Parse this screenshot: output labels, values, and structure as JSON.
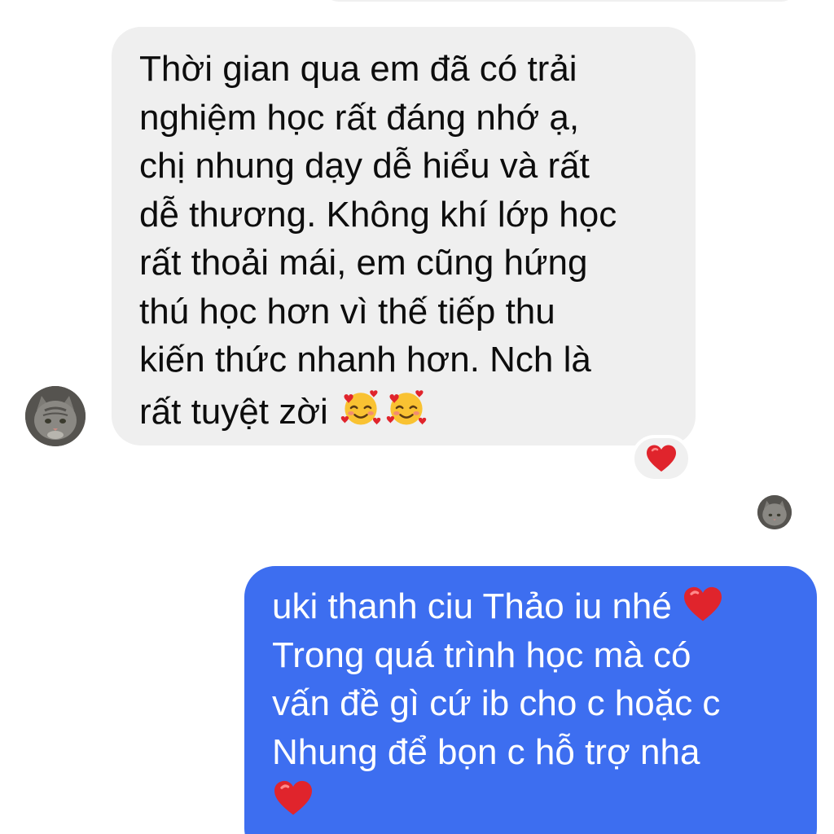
{
  "conversation": {
    "incoming_message": {
      "text_lines": [
        "Thời gian qua em đã có trải",
        "nghiệm học rất đáng nhớ ạ,",
        "chị nhung dạy dễ hiểu và rất",
        "dễ thương. Không khí lớp học",
        "rất thoải mái, em cũng hứng",
        "thú học hơn vì thế tiếp thu",
        "kiến thức nhanh hơn. Nch là",
        "rất tuyệt zời"
      ],
      "trailing_icons": [
        "smiling-face-with-hearts-icon",
        "smiling-face-with-hearts-icon"
      ],
      "reaction": "red-heart-icon",
      "sender_avatar": "cat-avatar"
    },
    "read_receipt_avatar": "cat-avatar",
    "outgoing_message": {
      "text_lines": [
        "uki thanh ciu Thảo iu nhé",
        "Trong quá trình học mà có",
        "vấn đề gì cứ ib cho c hoặc c",
        "Nhung để bọn c hỗ trợ nha"
      ],
      "inline_icons": [
        "red-heart-icon",
        "red-heart-icon"
      ]
    }
  },
  "colors": {
    "incoming_bubble": "#efefef",
    "outgoing_bubble": "#3d6ef0",
    "heart": "#e0242c"
  }
}
